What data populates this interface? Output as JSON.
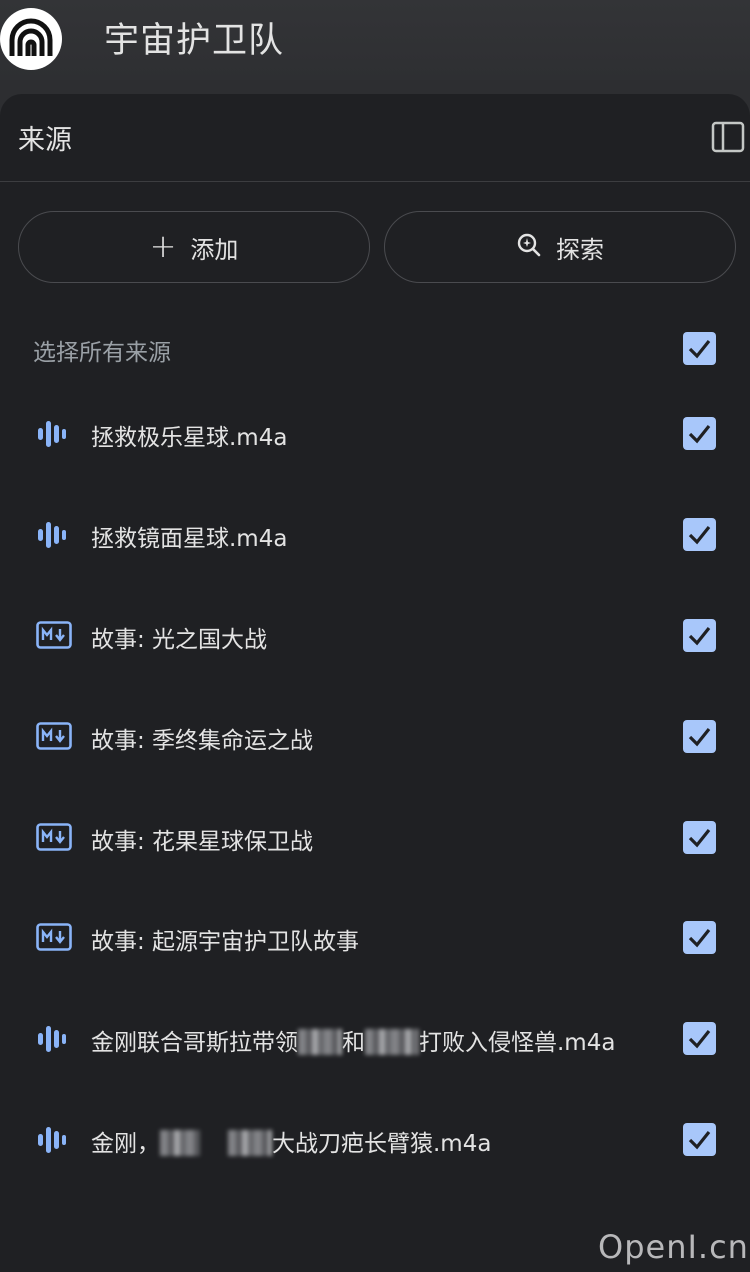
{
  "app": {
    "title": "宇宙护卫队",
    "logo_icon": "notebooklm-logo-icon"
  },
  "sources_panel": {
    "title": "来源",
    "collapse_icon": "side-panel-icon",
    "add_button": {
      "label": "添加",
      "icon": "plus-icon"
    },
    "discover_button": {
      "label": "探索",
      "icon": "sparkle-search-icon"
    },
    "select_all": {
      "label": "选择所有来源",
      "checked": true
    },
    "items": [
      {
        "type": "audio",
        "icon": "audio-icon",
        "pre": "拯救极乐星球.m4a",
        "post": "",
        "checked": true
      },
      {
        "type": "audio",
        "icon": "audio-icon",
        "pre": "拯救镜面星球.m4a",
        "post": "",
        "checked": true
      },
      {
        "type": "markdown",
        "icon": "markdown-icon",
        "pre": "故事: 光之国大战",
        "post": "",
        "checked": true
      },
      {
        "type": "markdown",
        "icon": "markdown-icon",
        "pre": "故事: 季终集命运之战",
        "post": "",
        "checked": true
      },
      {
        "type": "markdown",
        "icon": "markdown-icon",
        "pre": "故事: 花果星球保卫战",
        "post": "",
        "checked": true
      },
      {
        "type": "markdown",
        "icon": "markdown-icon",
        "pre": "故事: 起源宇宙护卫队故事",
        "post": "",
        "checked": true
      },
      {
        "type": "audio",
        "icon": "audio-icon",
        "pre": "金刚联合哥斯拉带领",
        "mid": "和",
        "post": "打败入侵怪兽.m4a",
        "checked": true
      },
      {
        "type": "audio",
        "icon": "audio-icon",
        "pre": "金刚，",
        "mid": "",
        "post": "大战刀疤长臂猿.m4a",
        "checked": true
      }
    ]
  },
  "watermark": "OpenI.cn",
  "colors": {
    "panel_bg": "#1f2023",
    "top_bg": "#2d2e31",
    "accent": "#a8c7fa",
    "icon_blue": "#8ab4f8",
    "check_mark": "#1f2023"
  }
}
